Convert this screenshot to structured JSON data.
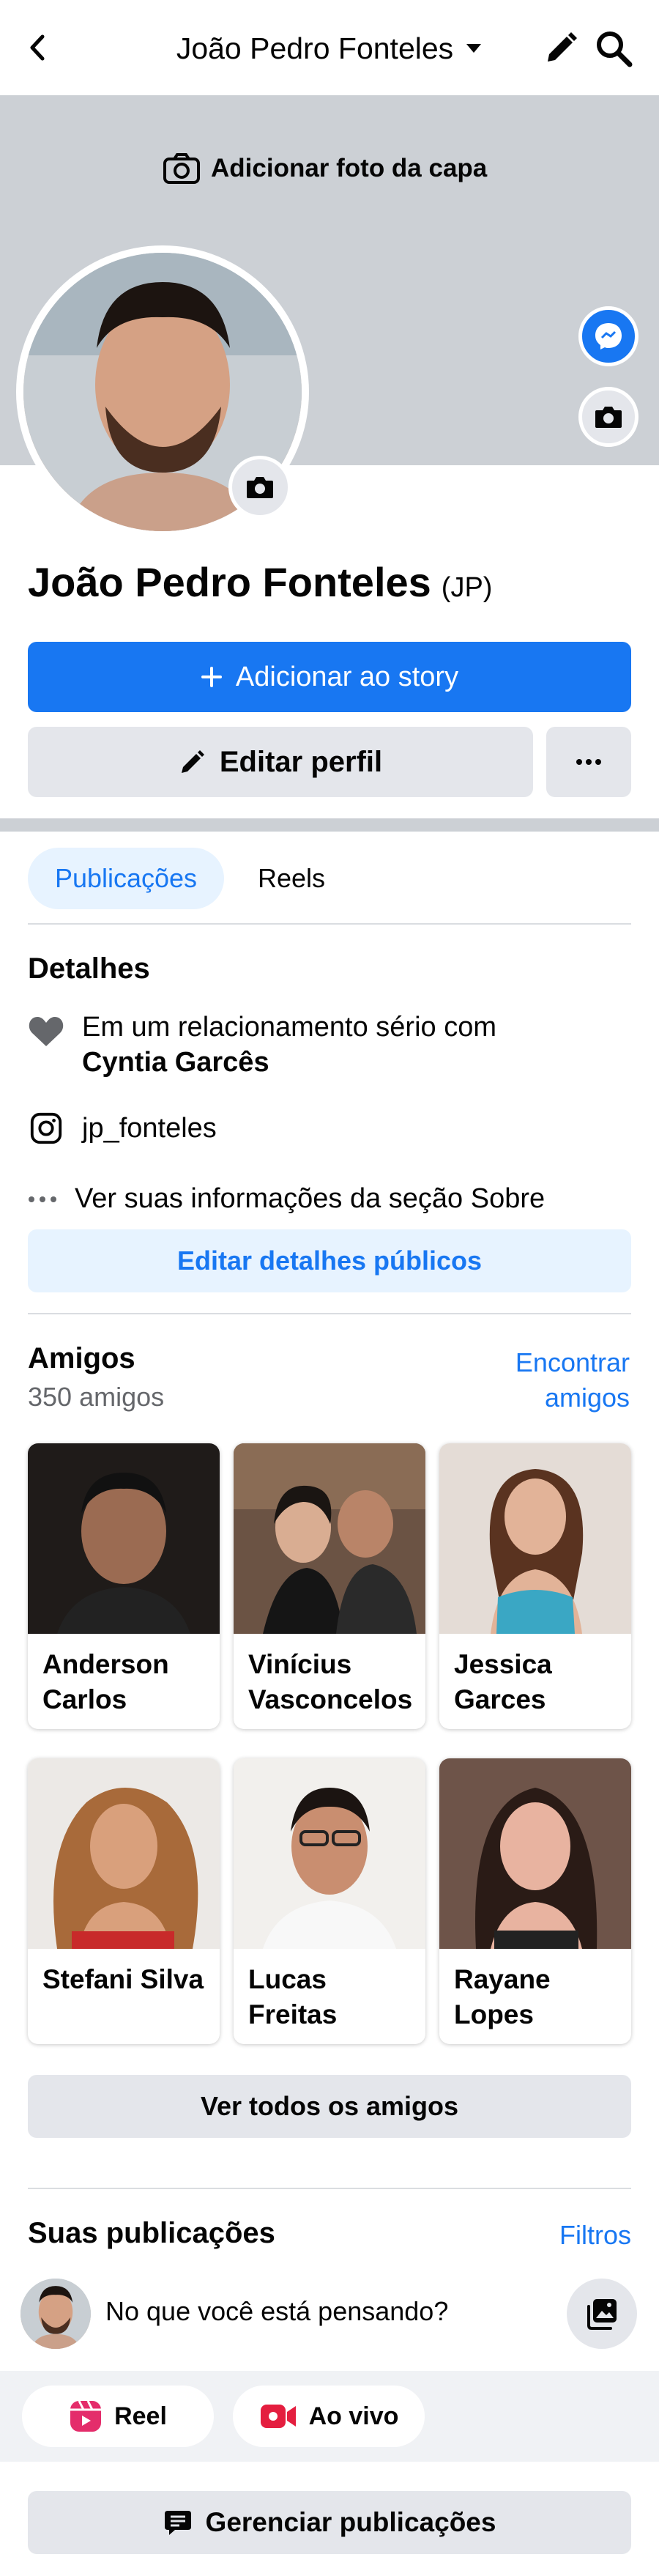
{
  "header": {
    "title": "João Pedro Fonteles"
  },
  "cover": {
    "add_label": "Adicionar foto da capa"
  },
  "profile": {
    "name": "João Pedro Fonteles",
    "nickname": "(JP)"
  },
  "actions": {
    "story_label": "Adicionar ao story",
    "edit_label": "Editar perfil"
  },
  "tabs": [
    {
      "label": "Publicações",
      "active": true
    },
    {
      "label": "Reels",
      "active": false
    }
  ],
  "details": {
    "title": "Detalhes",
    "relationship_prefix": "Em um relacionamento sério com",
    "relationship_partner": "Cyntia Garcês",
    "instagram": "jp_fonteles",
    "about": "Ver suas informações da seção Sobre",
    "edit_public": "Editar detalhes públicos"
  },
  "friends": {
    "title": "Amigos",
    "count": "350 amigos",
    "find_label": "Encontrar amigos",
    "list": [
      {
        "name": "Anderson Carlos",
        "color": "#2a2620"
      },
      {
        "name": "Vinícius Vasconcelos",
        "color": "#5a4a3c"
      },
      {
        "name": "Jessica Garces",
        "color": "#d9cfc8"
      },
      {
        "name": "Stefani Silva",
        "color": "#c9a07a"
      },
      {
        "name": "Lucas Freitas",
        "color": "#e6e3de"
      },
      {
        "name": "Rayane Lopes",
        "color": "#8b6a5a"
      }
    ],
    "all_label": "Ver todos os amigos"
  },
  "posts": {
    "title": "Suas publicações",
    "filters_label": "Filtros",
    "composer_placeholder": "No que você está pensando?",
    "reel_label": "Reel",
    "live_label": "Ao vivo",
    "manage_label": "Gerenciar publicações"
  },
  "colors": {
    "accent": "#1877f2",
    "reel": "#e42d6b",
    "live": "#e41e3f"
  }
}
